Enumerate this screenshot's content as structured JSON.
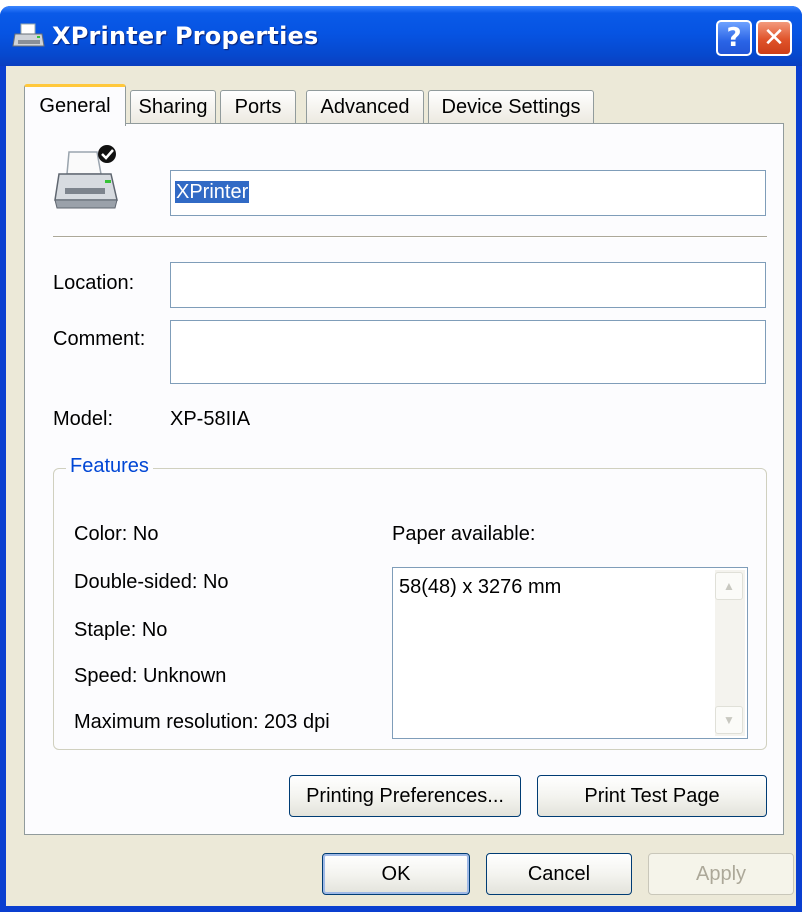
{
  "window": {
    "title": "XPrinter Properties",
    "help_label": "?",
    "close_label": "✕"
  },
  "tabs": [
    {
      "label": "General",
      "active": true
    },
    {
      "label": "Sharing",
      "active": false
    },
    {
      "label": "Ports",
      "active": false
    },
    {
      "label": "Advanced",
      "active": false
    },
    {
      "label": "Device Settings",
      "active": false
    }
  ],
  "general": {
    "printer_name": "XPrinter",
    "location_label": "Location:",
    "location_value": "",
    "comment_label": "Comment:",
    "comment_value": "",
    "model_label": "Model:",
    "model_value": "XP-58IIA"
  },
  "features": {
    "title": "Features",
    "color": "Color: No",
    "double_sided": "Double-sided: No",
    "staple": "Staple: No",
    "speed": "Speed: Unknown",
    "max_resolution": "Maximum resolution: 203 dpi",
    "paper_label": "Paper available:",
    "paper_items": [
      "58(48) x 3276 mm"
    ]
  },
  "buttons": {
    "printing_preferences": "Printing Preferences...",
    "print_test_page": "Print Test Page",
    "ok": "OK",
    "cancel": "Cancel",
    "apply": "Apply"
  },
  "colors": {
    "title_bar": "#0654e3",
    "dialog_bg": "#ece9d8",
    "selection": "#316ac5",
    "group_title": "#0046d5"
  }
}
